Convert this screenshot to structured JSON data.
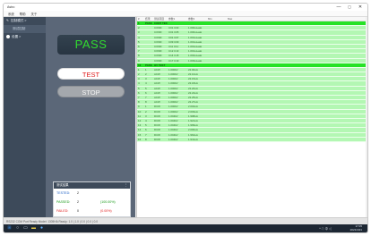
{
  "window": {
    "title": "Astro",
    "minimize": "—",
    "maximize": "▢",
    "close": "✕"
  },
  "menu": [
    "系统",
    "帮助",
    "关于"
  ],
  "nav": {
    "items": [
      {
        "label": "控制模式 >",
        "icon": "edit-icon",
        "sub": false
      },
      {
        "label": "测试控制",
        "icon": "",
        "sub": true
      },
      {
        "label": "设置 >",
        "icon": "settings-icon",
        "sub": false
      }
    ]
  },
  "control": {
    "result": "PASS",
    "result_color": "#31dc2f",
    "test_button": "TEST",
    "stop_button": "STOP"
  },
  "stats": {
    "title": "测试结果",
    "more": "⋮",
    "rows": [
      {
        "label": "TESTED:",
        "count": "2",
        "pct": ""
      },
      {
        "label": "PASSED:",
        "count": "2",
        "pct": "(100.00%)"
      },
      {
        "label": "FAILED:",
        "count": "0",
        "pct": "(0.00%)"
      }
    ]
  },
  "table": {
    "columns": [
      "#",
      "结果",
      "测试项目",
      "参数1",
      "参数2",
      "Min",
      "Max",
      ""
    ],
    "rows": [
      {
        "cells": [
          "1",
          "PASS",
          "CONT TEST",
          "",
          "",
          "",
          "",
          ""
        ],
        "group": true
      },
      {
        "cells": [
          "2",
          "",
          "COND",
          "C01 C03",
          "1.000uLeak",
          "",
          "",
          ""
        ],
        "group": false
      },
      {
        "cells": [
          "3",
          "",
          "COND",
          "C01 C05",
          "1.000uLeak",
          "",
          "",
          ""
        ],
        "group": false
      },
      {
        "cells": [
          "4",
          "",
          "COND",
          "C01 C07",
          "1.001uLeak",
          "",
          "",
          ""
        ],
        "group": false
      },
      {
        "cells": [
          "5",
          "",
          "COND",
          "C09 C09",
          "1.001uLeak",
          "",
          "",
          ""
        ],
        "group": false
      },
      {
        "cells": [
          "6",
          "",
          "COND",
          "C11 C11",
          "1.001uLeak",
          "",
          "",
          ""
        ],
        "group": false
      },
      {
        "cells": [
          "7",
          "",
          "COND",
          "C12 C13",
          "1.001uLeak",
          "",
          "",
          ""
        ],
        "group": false
      },
      {
        "cells": [
          "8",
          "",
          "COND",
          "C14 C15",
          "1.002uLeak",
          "",
          "",
          ""
        ],
        "group": false
      },
      {
        "cells": [
          "9",
          "",
          "COND",
          "C17 C19",
          "1.003uLeak",
          "",
          "",
          ""
        ],
        "group": false
      },
      {
        "cells": [
          "10",
          "PASS",
          "HV TEST",
          "",
          "",
          "",
          "",
          ""
        ],
        "group": true
      },
      {
        "cells": [
          "1",
          "1",
          "ACW",
          "1.000kV",
          "22.00uA",
          "",
          "",
          ""
        ],
        "group": false
      },
      {
        "cells": [
          "2",
          "2",
          "ACW",
          "1.000kV",
          "22.10uA",
          "",
          "",
          ""
        ],
        "group": false
      },
      {
        "cells": [
          "3",
          "3",
          "ACW",
          "1.000kV",
          "22.15uA",
          "",
          "",
          ""
        ],
        "group": false
      },
      {
        "cells": [
          "4",
          "4",
          "ACW",
          "1.000kV",
          "22.18uA",
          "",
          "",
          ""
        ],
        "group": false
      },
      {
        "cells": [
          "5",
          "5",
          "ACW",
          "1.000kV",
          "22.20uA",
          "",
          "",
          ""
        ],
        "group": false
      },
      {
        "cells": [
          "6",
          "6",
          "ACW",
          "1.000kV",
          "22.22uA",
          "",
          "",
          ""
        ],
        "group": false
      },
      {
        "cells": [
          "7",
          "7",
          "ACW",
          "1.000kV",
          "22.25uA",
          "",
          "",
          ""
        ],
        "group": false
      },
      {
        "cells": [
          "8",
          "8",
          "ACW",
          "1.000kV",
          "22.27uA",
          "",
          "",
          ""
        ],
        "group": false
      },
      {
        "cells": [
          "9",
          "1",
          "DCW",
          "1.000kV",
          "2.002uA",
          "",
          "",
          ""
        ],
        "group": false
      },
      {
        "cells": [
          "10",
          "2",
          "DCW",
          "1.000kV",
          "2.003uA",
          "",
          "",
          ""
        ],
        "group": false
      },
      {
        "cells": [
          "11",
          "3",
          "DCW",
          "1.004kV",
          "1.998uA",
          "",
          "",
          ""
        ],
        "group": false
      },
      {
        "cells": [
          "12",
          "4",
          "DCW",
          "1.004kV",
          "1.921uA",
          "",
          "",
          ""
        ],
        "group": false
      },
      {
        "cells": [
          "13",
          "5",
          "DCW",
          "1.004kV",
          "1.999uA",
          "",
          "",
          ""
        ],
        "group": false
      },
      {
        "cells": [
          "14",
          "6",
          "DCW",
          "1.004kV",
          "2.000uA",
          "",
          "",
          ""
        ],
        "group": false
      },
      {
        "cells": [
          "15",
          "7",
          "DCW",
          "1.004kV",
          "1.964uA",
          "",
          "",
          ""
        ],
        "group": false
      },
      {
        "cells": [
          "16",
          "8",
          "DCW",
          "1.004kV",
          "1.941uA",
          "",
          "",
          ""
        ],
        "group": false
      }
    ]
  },
  "statusbar": {
    "text": "RS232 COM Port Ready    Model: 1305HA    Ready: 1.0 | 1.0 | 0.0 | 0.0 | 0.0"
  },
  "taskbar": {
    "tray_icons": "^  ☁  中  ◁",
    "time": "17:05",
    "date": "2021/4/21"
  }
}
